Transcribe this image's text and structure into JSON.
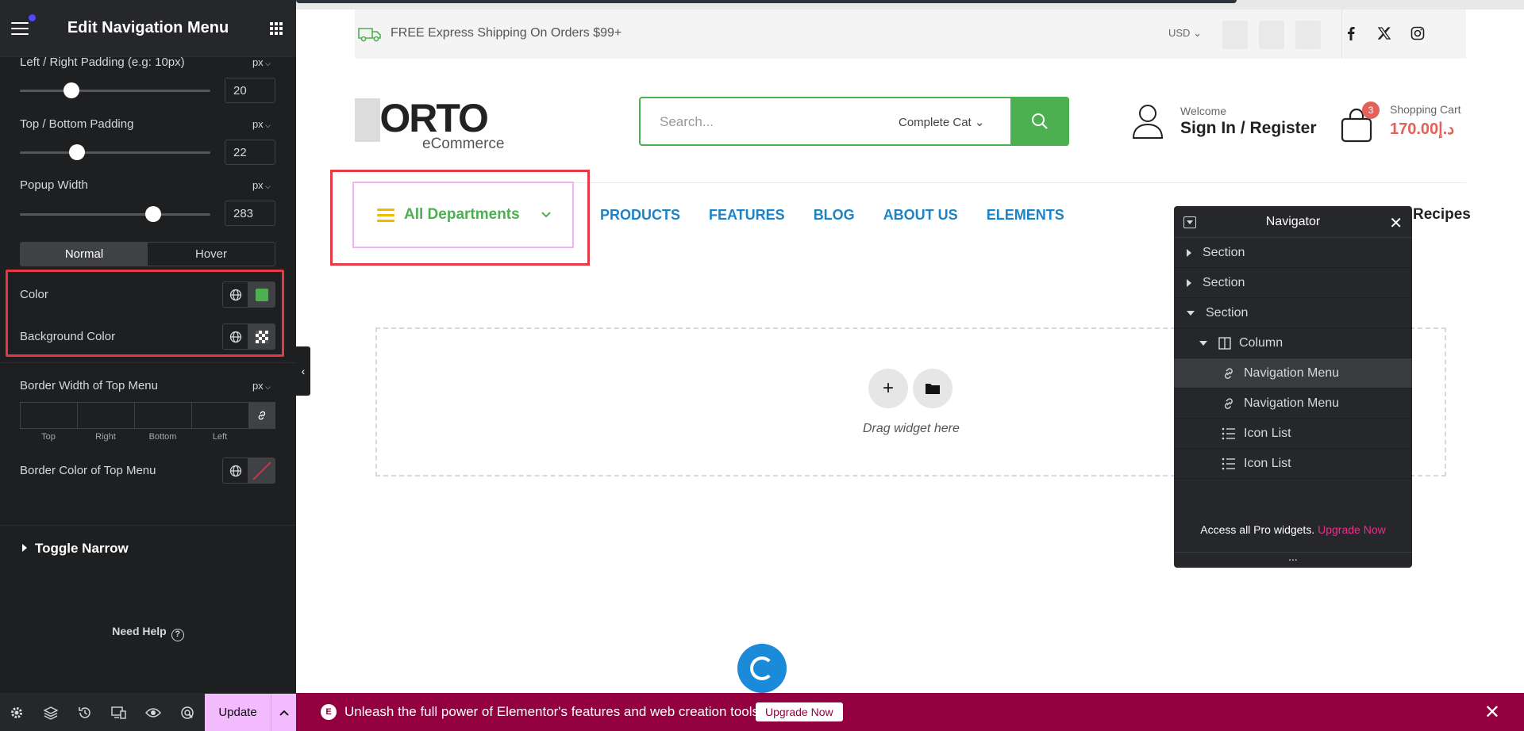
{
  "panel": {
    "title": "Edit Navigation Menu",
    "controls": {
      "lr_padding": {
        "label": "Left / Right Padding (e.g: 10px)",
        "unit": "px",
        "value": "20",
        "level": 0.25
      },
      "tb_padding": {
        "label": "Top / Bottom Padding",
        "unit": "px",
        "value": "22",
        "level": 0.28
      },
      "popup_width": {
        "label": "Popup Width",
        "unit": "px",
        "value": "283",
        "level": 0.72
      }
    },
    "tabs": [
      "Normal",
      "Hover"
    ],
    "color_label": "Color",
    "color_value": "#4caf50",
    "bg_color_label": "Background Color",
    "border_width": {
      "label": "Border Width of Top Menu",
      "unit": "px",
      "sides": [
        "Top",
        "Right",
        "Bottom",
        "Left"
      ]
    },
    "border_color_label": "Border Color of Top Menu",
    "toggle_section": "Toggle Narrow",
    "need_help": "Need Help",
    "update_label": "Update"
  },
  "site": {
    "shipping": "FREE Express Shipping On Orders $99+",
    "currency": "USD",
    "logo_main": "PORTO",
    "logo_sub": "eCommerce",
    "search_placeholder": "Search...",
    "search_category": "Complete Cat",
    "welcome": "Welcome",
    "sign_in": "Sign In / Register",
    "cart_count": "3",
    "cart_label": "Shopping Cart",
    "cart_amount": "170.00د.إ",
    "departments": "All Departments",
    "menu": [
      "PRODUCTS",
      "FEATURES",
      "BLOG",
      "ABOUT US",
      "ELEMENTS"
    ],
    "recipes": "Recipes",
    "drag_text": "Drag widget here"
  },
  "navigator": {
    "title": "Navigator",
    "items": [
      {
        "label": "Section",
        "depth": 0,
        "state": "collapsed"
      },
      {
        "label": "Section",
        "depth": 0,
        "state": "collapsed"
      },
      {
        "label": "Section",
        "depth": 0,
        "state": "expanded"
      },
      {
        "label": "Column",
        "depth": 1,
        "state": "expanded"
      },
      {
        "label": "Navigation Menu",
        "depth": 2,
        "state": "selected"
      },
      {
        "label": "Navigation Menu",
        "depth": 2,
        "state": "leaf"
      },
      {
        "label": "Icon List",
        "depth": 2,
        "state": "leaf"
      },
      {
        "label": "Icon List",
        "depth": 2,
        "state": "leaf"
      }
    ],
    "promo_text": "Access all Pro widgets.",
    "promo_link": "Upgrade Now",
    "more": "..."
  },
  "promo_bar": {
    "message": "Unleash the full power of Elementor's features and web creation tools.",
    "button": "Upgrade Now"
  }
}
